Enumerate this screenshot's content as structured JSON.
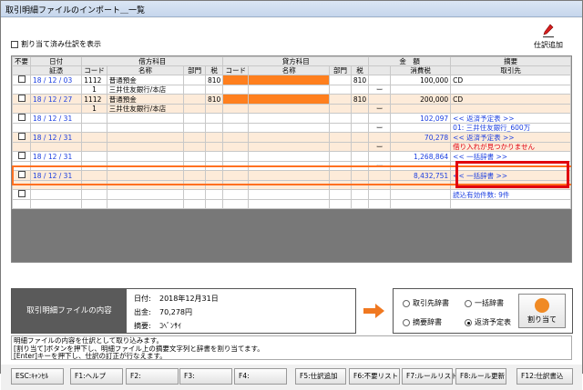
{
  "window": {
    "title": "取引明細ファイルのインポート＿一覧"
  },
  "top": {
    "checkbox_label": "割り当て済み仕訳を表示",
    "shiwake_label": "仕訳追加"
  },
  "columns": {
    "unnecessary": "不要",
    "date": "日付",
    "voucher": "証憑",
    "debit_group": "借方科目",
    "credit_group": "貸方科目",
    "code": "コード",
    "name": "名称",
    "dept": "部門",
    "tax": "税",
    "amount_group": "金　額",
    "tax_amount": "消費税",
    "summary_group": "摘要",
    "partner": "取引先"
  },
  "rows": [
    {
      "date": "18 / 12 / 03",
      "dcode": "1112",
      "dname": "普通預金",
      "dtax": "810",
      "ctax": "810",
      "amount": "100,000",
      "summary": "CD"
    },
    {
      "dcode": "1",
      "dname": "三井住友銀行/本店",
      "dash": "ー"
    },
    {
      "date": "18 / 12 / 27",
      "dcode": "1112",
      "dname": "普通預金",
      "dtax": "810",
      "ctax": "810",
      "amount": "200,000",
      "summary": "CD"
    },
    {
      "dcode": "1",
      "dname": "三井住友銀行/本店",
      "dash": "ー"
    },
    {
      "date": "18 / 12 / 31",
      "amount": "102,097",
      "summary": "<< 返済予定表 >>"
    },
    {
      "dash": "ー",
      "partner": "01: 三井住友銀行_600万"
    },
    {
      "date": "18 / 12 / 31",
      "amount": "70,278",
      "summary": "<< 返済予定表 >>"
    },
    {
      "dash": "ー",
      "partner": "借り入れが見つかりません"
    },
    {
      "date": "18 / 12 / 31",
      "amount": "1,268,864",
      "summary": "<< 一括辞書 >>"
    },
    {
      "dash": "ー"
    },
    {
      "date": "18 / 12 / 31",
      "amount": "8,432,751",
      "summary": "<< 一括辞書 >>"
    },
    {
      "dash": "ー"
    },
    {
      "summary": "読込有効件数: 9件"
    }
  ],
  "info": {
    "heading": "取引明細ファイルの内容",
    "date_label": "日付:",
    "date_value": "2018年12月31日",
    "out_label": "出金:",
    "out_value": "70,278円",
    "summary_label": "摘要:",
    "summary_value": "ｺﾍﾞﾝｻｲ"
  },
  "options": {
    "partner_dict": "取引先辞書",
    "bulk_dict": "一括辞書",
    "summary_dict": "摘要辞書",
    "repayment": "返済予定表",
    "assign_button": "割り当て"
  },
  "message": [
    "明細ファイルの内容を仕訳として取り込みます。",
    "[割り当て]ボタンを押下し、明細ファイル上の摘要文字列と辞書を割り当てます。",
    "[Enter]キーを押下し、仕訳の訂正が行なえます。"
  ],
  "fkeys": [
    "ESC:ｷｬﾝｾﾙ",
    "F1:ヘルプ",
    "F2:",
    "F3:",
    "F4:",
    "F5:仕訳追加",
    "F6:不要リスト",
    "F7:ルールリスト",
    "F8:ルール更新",
    "F12:仕訳書込"
  ],
  "colors": {
    "highlight": "#ff7f1e",
    "pink_row": "#fdebd9",
    "link_blue": "#1a3ee0",
    "error_red": "#e00010"
  }
}
